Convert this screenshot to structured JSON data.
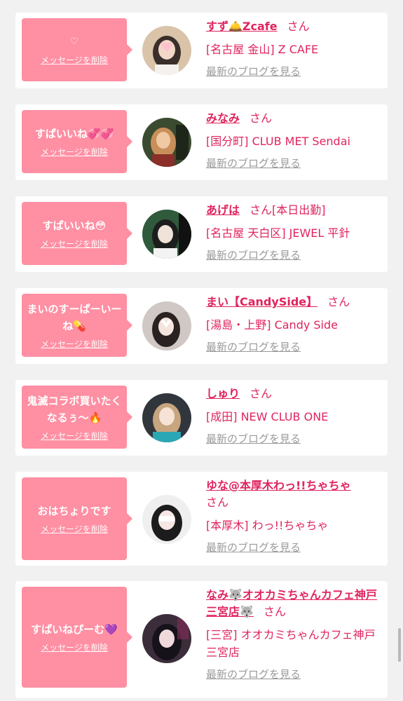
{
  "cards": [
    {
      "msg": "♡",
      "delete_label": "メッセージを削除",
      "name": "すず🛎️Zcafe",
      "suffix": "さん",
      "store": "[名古屋 金山] Z CAFE",
      "blog_link": "最新のブログを見る",
      "avatar_colors": [
        "#d9c3a9",
        "#3a2e2a",
        "#f2d7c7"
      ]
    },
    {
      "msg": "すぱいいね💞💞",
      "delete_label": "メッセージを削除",
      "name": "みなみ",
      "suffix": "さん",
      "store": "[国分町] CLUB MET Sendai",
      "blog_link": "最新のブログを見る",
      "avatar_colors": [
        "#3b4b2f",
        "#c98f5a",
        "#f0c9a4"
      ]
    },
    {
      "msg": "すぱいいね😳",
      "delete_label": "メッセージを削除",
      "name": "あげは",
      "suffix": "さん[本日出勤]",
      "store": "[名古屋 天白区] JEWEL 平針",
      "blog_link": "最新のブログを見る",
      "avatar_colors": [
        "#2f5a3c",
        "#1d1d1d",
        "#efe2d8"
      ]
    },
    {
      "msg": "まいのすーぱーいーね💊",
      "delete_label": "メッセージを削除",
      "name": "まい【CandySide】",
      "suffix": "さん",
      "store": "[湯島・上野] Candy Side",
      "blog_link": "最新のブログを見る",
      "avatar_colors": [
        "#cfc8c4",
        "#2a2220",
        "#f4e4dc"
      ]
    },
    {
      "msg": "鬼滅コラボ買いたくなるぅ〜🔥",
      "delete_label": "メッセージを削除",
      "name": "しゅり",
      "suffix": "さん",
      "store": "[成田] NEW CLUB ONE",
      "blog_link": "最新のブログを見る",
      "avatar_colors": [
        "#31363c",
        "#c7a57f",
        "#f6e3d6"
      ]
    },
    {
      "msg": "おはちょりです",
      "delete_label": "メッセージを削除",
      "name": "ゆな@本厚木わっ!!ちゃちゃ",
      "suffix": "さん",
      "store": "[本厚木] わっ!!ちゃちゃ",
      "blog_link": "最新のブログを見る",
      "avatar_colors": [
        "#efefef",
        "#1c1c1c",
        "#f7e6e3"
      ]
    },
    {
      "msg": "すぱいねぴーむ💜",
      "delete_label": "メッセージを削除",
      "name": "なみ🐺オオカミちゃんカフェ神戸三宮店🐺",
      "suffix": "さん",
      "store": "[三宮] オオカミちゃんカフェ神戸三宮店",
      "blog_link": "最新のブログを見る",
      "avatar_colors": [
        "#3c2d3a",
        "#15121a",
        "#f0d9dc"
      ]
    }
  ]
}
